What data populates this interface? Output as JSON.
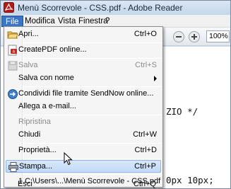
{
  "window": {
    "title": "Menù Scorrevole - CSS.pdf - Adobe Reader"
  },
  "menubar": {
    "items": [
      {
        "label": "File",
        "active": true
      },
      {
        "label": "Modifica"
      },
      {
        "label": "Vista"
      },
      {
        "label": "Finestra"
      },
      {
        "label": "?"
      }
    ]
  },
  "toolbar": {
    "zoom": "100%"
  },
  "document": {
    "lines": [
      "ZIO */",
      "0px 10px;"
    ]
  },
  "file_menu": {
    "items": [
      {
        "label": "Apri...",
        "shortcut": "Ctrl+O",
        "icon": "open-folder-icon"
      },
      {
        "label": "CreatePDF online...",
        "icon": "createpdf-icon"
      },
      {
        "label": "Salva",
        "shortcut": "Ctrl+S",
        "disabled": true,
        "icon": "save-disabled-icon"
      },
      {
        "label": "Salva con nome",
        "submenu": true
      },
      {
        "label": "Condividi file tramite SendNow online...",
        "icon": "sendnow-icon"
      },
      {
        "label": "Allega a e-mail..."
      },
      {
        "label": "Ripristina",
        "disabled": true
      },
      {
        "label": "Chiudi",
        "shortcut": "Ctrl+W"
      },
      {
        "label": "Proprietà...",
        "shortcut": "Ctrl+D"
      },
      {
        "label": "Stampa...",
        "shortcut": "Ctrl+P",
        "highlighted": true,
        "icon": "printer-icon"
      },
      {
        "label": "1 C:\\Users\\...\\Menù Scorrevole - CSS.pdf"
      },
      {
        "label": "Esci",
        "shortcut": "Ctrl+Q"
      }
    ]
  },
  "colors": {
    "menu_highlight": "#c1daf7",
    "active_menu": "#3a76c5",
    "title_bar": "#c3d6ea"
  }
}
